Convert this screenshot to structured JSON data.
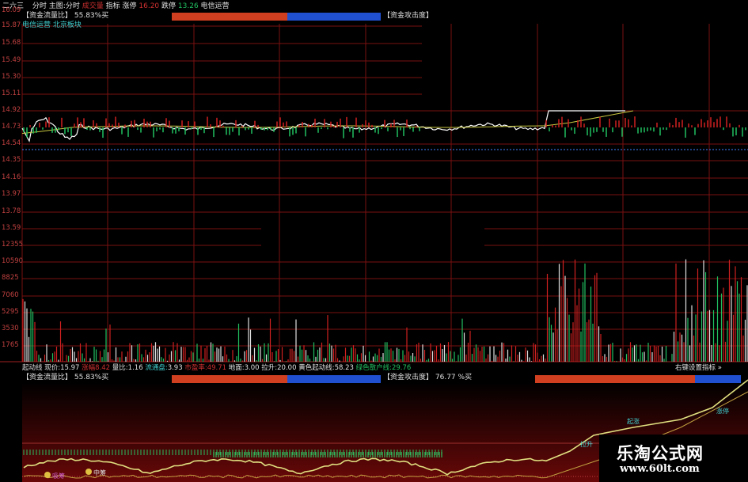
{
  "header": {
    "code": "二六三",
    "menu": [
      "分时",
      "主图:分时",
      "成交量",
      "指标"
    ],
    "limit_up_label": "涨停",
    "limit_up_value": "16.20",
    "limit_down_label": "跌停",
    "limit_down_value": "13.26",
    "sector": "电信运营"
  },
  "sub_header": {
    "left_title": "【资金流量比】",
    "left_value": "55.83%买",
    "right_title": "【资金攻击度】",
    "tag1": "电信运营",
    "tag2": "北京板块"
  },
  "y_axis": [
    "16.09",
    "15.87",
    "15.68",
    "15.49",
    "15.30",
    "15.11",
    "14.92",
    "14.73",
    "14.54",
    "14.35",
    "14.16",
    "13.97",
    "13.78",
    "13.59",
    "12355",
    "10590",
    "8825",
    "7060",
    "5295",
    "3530",
    "1765"
  ],
  "info_line": {
    "indicator": "起动线",
    "price_label": "现价:",
    "price": "15.97",
    "change_label": "涨幅",
    "change": "8.42",
    "vol_ratio_label": "量比:",
    "vol_ratio": "1.16",
    "float_label": "流通盘:",
    "float": "3.93",
    "turnover_label": "市盈率:",
    "turnover": "49.71",
    "base_label": "地面:",
    "base": "3.00",
    "pull_label": "拉升:",
    "pull": "20.00",
    "yellow_label": "黄色起动线:",
    "yellow": "58.23",
    "green_label": "绿色散户线:",
    "green": "29.76",
    "settings": "右键设置指标 »"
  },
  "lower_header": {
    "left_title": "【资金流量比】",
    "left_value": "55.83%买",
    "right_title": "【资金攻击度】",
    "right_value": "76.77 %买"
  },
  "annotations": {
    "bottom_left_1": "吸筹",
    "bottom_left_2": "中筹",
    "right_1": "拉升",
    "right_2": "起涨",
    "right_3": "涨停"
  },
  "watermark": {
    "title": "乐淘公式网",
    "url": "www.60lt.com"
  },
  "colors": {
    "up": "#d02020",
    "down": "#20c060",
    "price_line": "#ffffff",
    "avg_line": "#c8c840",
    "grid": "#7a1010",
    "bar_red": "#d04020",
    "bar_blue": "#2050d0"
  }
}
